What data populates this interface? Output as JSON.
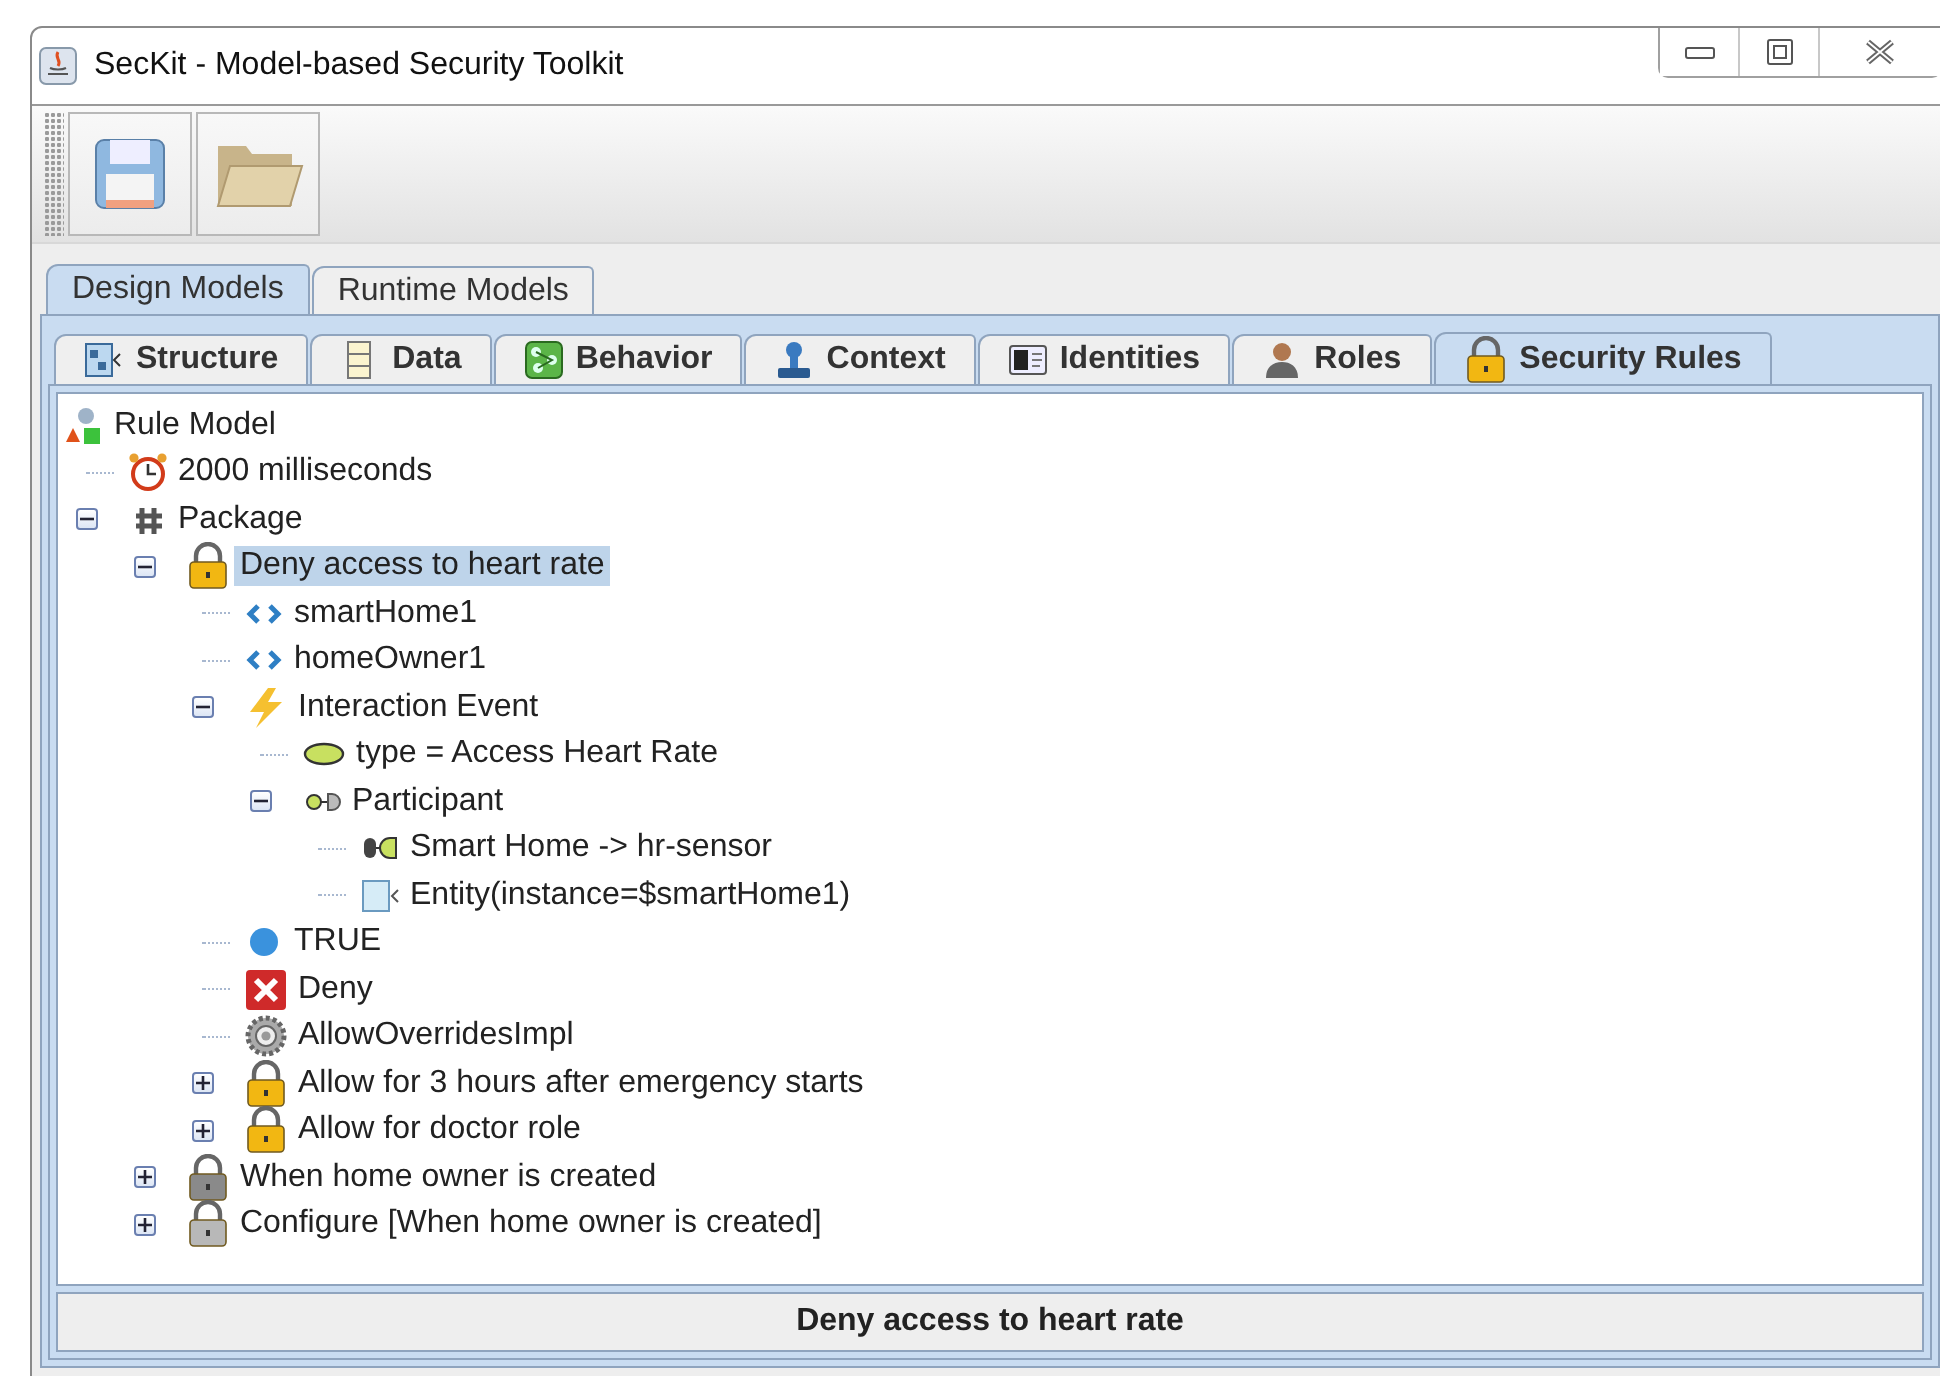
{
  "window": {
    "title": "SecKit - Model-based Security Toolkit"
  },
  "toolbar": [
    {
      "kind": "save"
    },
    {
      "kind": "open"
    }
  ],
  "model_tabs": [
    {
      "label": "Design Models",
      "selected": true
    },
    {
      "label": "Runtime Models",
      "selected": false
    }
  ],
  "view_tabs": [
    {
      "label": "Structure",
      "kind": "structure",
      "selected": false
    },
    {
      "label": "Data",
      "kind": "data",
      "selected": false
    },
    {
      "label": "Behavior",
      "kind": "behavior",
      "selected": false
    },
    {
      "label": "Context",
      "kind": "context",
      "selected": false
    },
    {
      "label": "Identities",
      "kind": "identities",
      "selected": false
    },
    {
      "label": "Roles",
      "kind": "roles",
      "selected": false
    },
    {
      "label": "Security Rules",
      "kind": "lock",
      "selected": true
    }
  ],
  "tree": {
    "label": "Rule Model",
    "kind": "model",
    "selected": false,
    "children": [
      {
        "label": "2000 milliseconds",
        "kind": "clock",
        "selected": false
      },
      {
        "label": "Package",
        "kind": "package",
        "expanded": true,
        "selected": false,
        "children": [
          {
            "label": "Deny access to heart rate",
            "kind": "lock",
            "color": "#f2b712",
            "expanded": true,
            "selected": true,
            "children": [
              {
                "label": "smartHome1",
                "kind": "variable",
                "selected": false
              },
              {
                "label": "homeOwner1",
                "kind": "variable",
                "selected": false
              },
              {
                "label": "Interaction Event",
                "kind": "event",
                "expanded": true,
                "selected": false,
                "children": [
                  {
                    "label": "type = Access Heart Rate",
                    "kind": "attribute",
                    "selected": false
                  },
                  {
                    "label": "Participant",
                    "kind": "participant",
                    "expanded": true,
                    "selected": false,
                    "children": [
                      {
                        "label": "Smart Home -> hr-sensor",
                        "kind": "connector",
                        "selected": false
                      },
                      {
                        "label": "Entity(instance=$smartHome1)",
                        "kind": "entity",
                        "selected": false
                      }
                    ]
                  }
                ]
              },
              {
                "label": "TRUE",
                "kind": "condition",
                "selected": false
              },
              {
                "label": "Deny",
                "kind": "deny",
                "selected": false
              },
              {
                "label": "AllowOverridesImpl",
                "kind": "gear",
                "selected": false
              },
              {
                "label": "Allow for 3 hours after emergency starts",
                "kind": "lock",
                "color": "#f2b712",
                "expanded": false,
                "selected": false
              },
              {
                "label": "Allow for doctor role",
                "kind": "lock",
                "color": "#f2b712",
                "expanded": false,
                "selected": false
              }
            ]
          },
          {
            "label": "When home owner is created",
            "kind": "lock",
            "color": "#8a8a8a",
            "expanded": false,
            "selected": false
          },
          {
            "label": "Configure [When home owner is created]",
            "kind": "lock",
            "color": "#b8b8b8",
            "expanded": false,
            "selected": false
          }
        ]
      }
    ]
  },
  "status_bar": {
    "text": "Deny access to heart rate"
  }
}
